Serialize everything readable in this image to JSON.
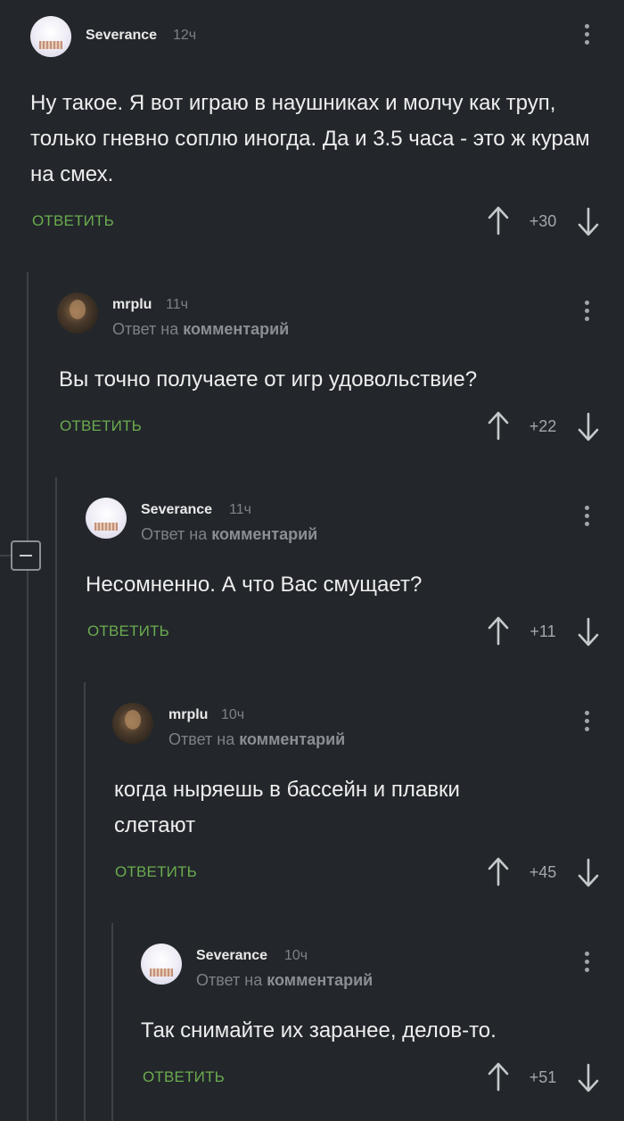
{
  "comments": [
    {
      "author": "Severance",
      "time": "12ч",
      "text": "Ну такое. Я вот играю в наушниках и молчу как труп, только гневно соплю иногда. Да и 3.5 часа - это ж курам на смех.",
      "reply_label": "ОТВЕТИТЬ",
      "score": "+30"
    },
    {
      "author": "mrplu",
      "time": "11ч",
      "reply_prefix": "Ответ на",
      "reply_target": "комментарий",
      "text": "Вы точно получаете от игр удовольствие?",
      "reply_label": "ОТВЕТИТЬ",
      "score": "+22"
    },
    {
      "author": "Severance",
      "time": "11ч",
      "reply_prefix": "Ответ на",
      "reply_target": "комментарий",
      "text": "Несомненно. А что Вас смущает?",
      "reply_label": "ОТВЕТИТЬ",
      "score": "+11"
    },
    {
      "author": "mrplu",
      "time": "10ч",
      "reply_prefix": "Ответ на",
      "reply_target": "комментарий",
      "text": "когда ныряешь в бассейн и плавки слетают",
      "reply_label": "ОТВЕТИТЬ",
      "score": "+45"
    },
    {
      "author": "Severance",
      "time": "10ч",
      "reply_prefix": "Ответ на",
      "reply_target": "комментарий",
      "text": "Так снимайте их заранее, делов-то.",
      "reply_label": "ОТВЕТИТЬ",
      "score": "+51"
    }
  ],
  "colors": {
    "background": "#23272b",
    "reply_link": "#6bab4f",
    "muted_text": "#7d8286",
    "thread_line": "#3c4247"
  },
  "icons": [
    "more-vertical-icon",
    "arrow-up-icon",
    "arrow-down-icon",
    "collapse-minus-icon"
  ]
}
